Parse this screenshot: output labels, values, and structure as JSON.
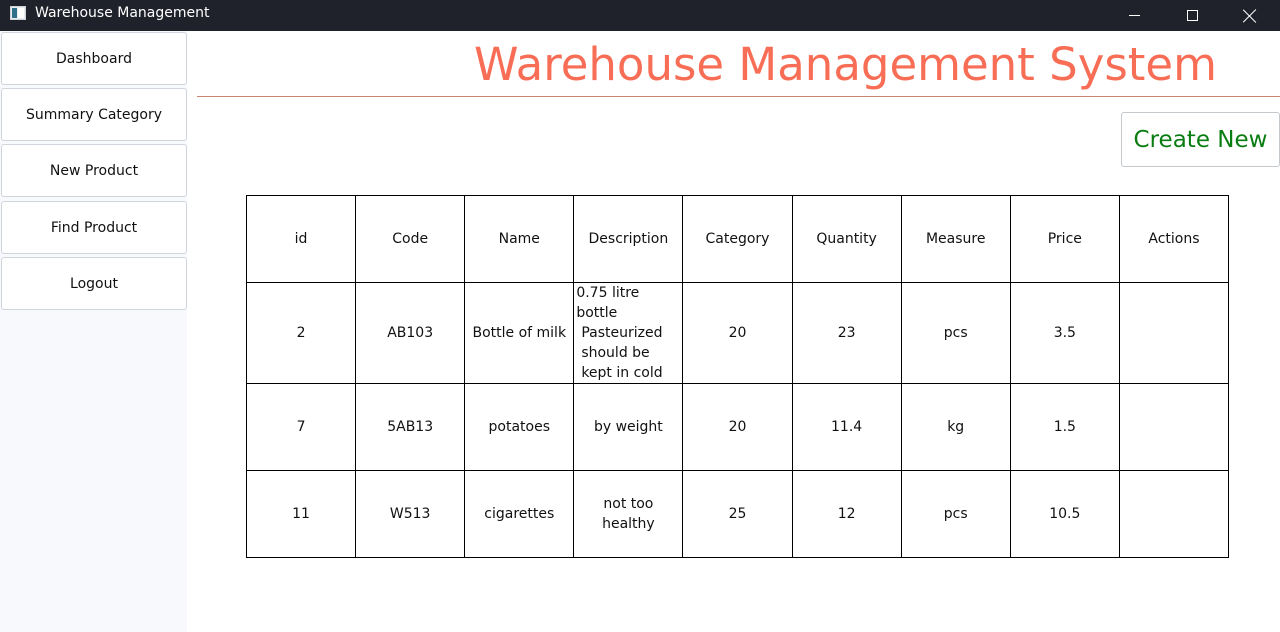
{
  "window": {
    "title": "Warehouse Management"
  },
  "sidebar": {
    "items": [
      {
        "label": "Dashboard"
      },
      {
        "label": "Summary Category"
      },
      {
        "label": "New Product"
      },
      {
        "label": "Find Product"
      },
      {
        "label": "Logout"
      }
    ]
  },
  "header": {
    "title": "Warehouse Management System",
    "title_color": "#f76d55"
  },
  "actions": {
    "create_label": "Create New",
    "create_color": "#0a7d12"
  },
  "table": {
    "columns": [
      "id",
      "Code",
      "Name",
      "Description",
      "Category",
      "Quantity",
      "Measure",
      "Price",
      "Actions"
    ],
    "rows": [
      {
        "id": "2",
        "code": "AB103",
        "name": "Bottle of milk",
        "description": [
          "0.75 litre bottle",
          "Pasteurized",
          "should be",
          "kept in cold"
        ],
        "category": "20",
        "quantity": "23",
        "measure": "pcs",
        "price": "3.5",
        "actions": ""
      },
      {
        "id": "7",
        "code": "5AB13",
        "name": "potatoes",
        "description": [
          "by weight"
        ],
        "category": "20",
        "quantity": "11.4",
        "measure": "kg",
        "price": "1.5",
        "actions": ""
      },
      {
        "id": "11",
        "code": "W513",
        "name": "cigarettes",
        "description": [
          "not too healthy"
        ],
        "category": "25",
        "quantity": "12",
        "measure": "pcs",
        "price": "10.5",
        "actions": ""
      }
    ]
  }
}
